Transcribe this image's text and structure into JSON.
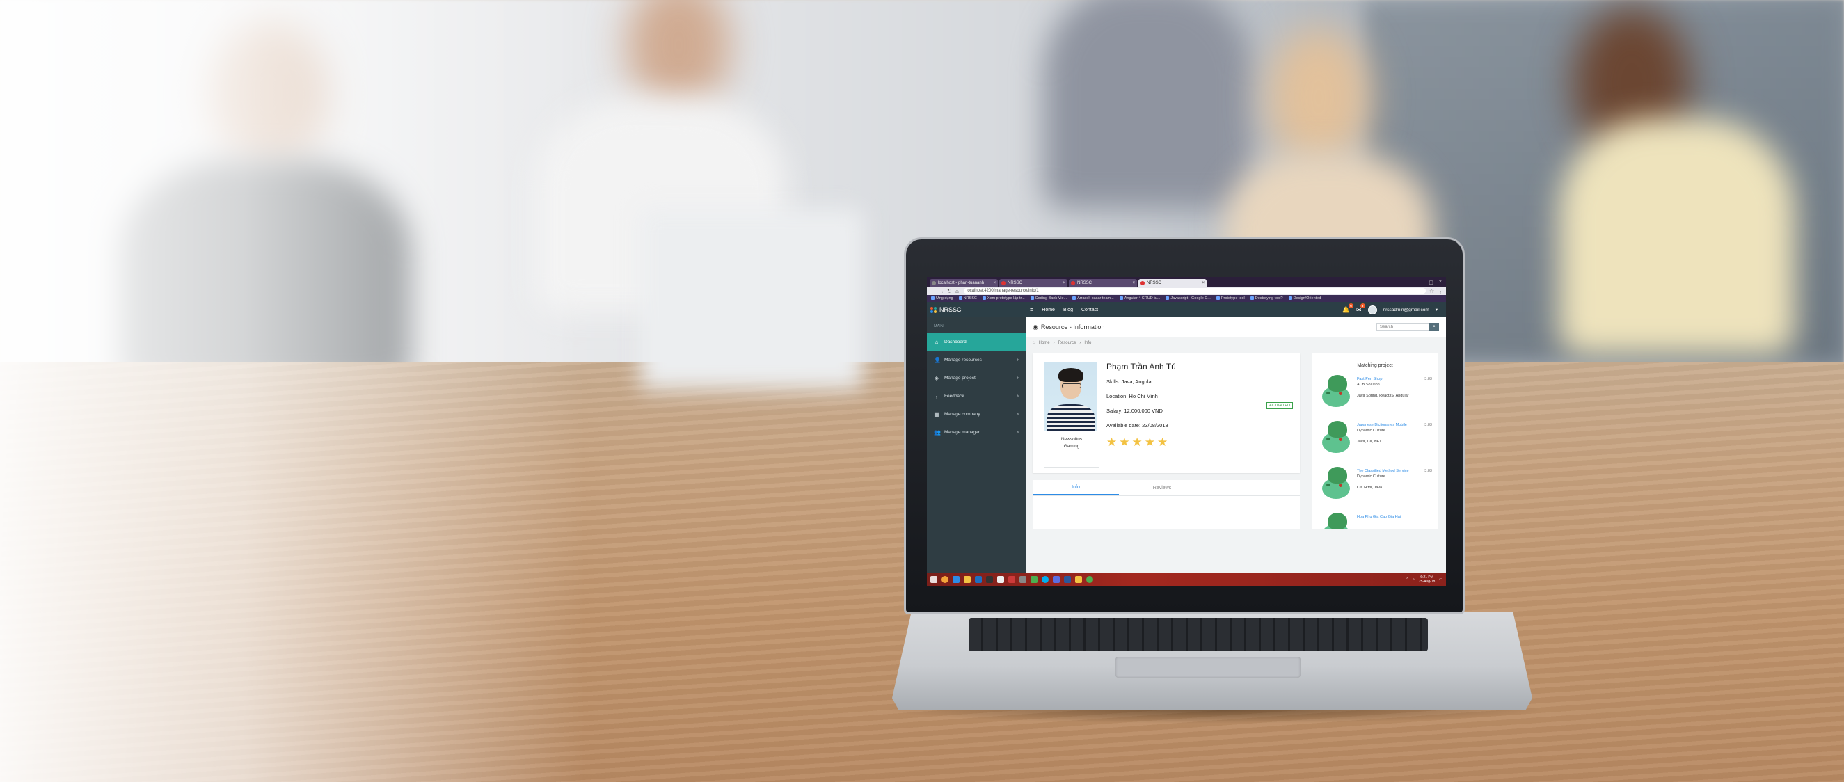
{
  "browser": {
    "tabs": [
      {
        "title": "localhost - phan-tuananh",
        "active": false
      },
      {
        "title": "NRSSC",
        "active": false
      },
      {
        "title": "NRSSC",
        "active": false
      },
      {
        "title": "NRSSC",
        "active": true
      }
    ],
    "url": "localhost:4200/manage-resource/info/1",
    "bookmarks": [
      "Ứng dụng",
      "NRSSC",
      "Xem prototype lập tr...",
      "Coding Bank Vie...",
      "Arrasek pasar team...",
      "Angular 4 CRUD tu...",
      "Javascript - Google D...",
      "Prototype tool",
      "Destroying tool?",
      "Design/Oriented"
    ]
  },
  "app": {
    "brand": "NRSSC",
    "topnav": [
      "Home",
      "Blog",
      "Contact"
    ],
    "notifications": [
      "6",
      "5"
    ],
    "user_email": "nrssadmin@gmail.com",
    "sidebar": {
      "caption": "MAIN",
      "items": [
        {
          "label": "Dashboard",
          "icon": "home-icon",
          "active": true,
          "has_children": false
        },
        {
          "label": "Manage resources",
          "icon": "users-icon",
          "active": false,
          "has_children": true
        },
        {
          "label": "Manage project",
          "icon": "layers-icon",
          "active": false,
          "has_children": true
        },
        {
          "label": "Feedback",
          "icon": "feedback-icon",
          "active": false,
          "has_children": true
        },
        {
          "label": "Manage company",
          "icon": "building-icon",
          "active": false,
          "has_children": true
        },
        {
          "label": "Manage manager",
          "icon": "group-icon",
          "active": false,
          "has_children": true
        }
      ]
    },
    "page_title": "Resource - Information",
    "search_placeholder": "Search",
    "breadcrumb": [
      "Home",
      "Resource",
      "Info"
    ],
    "profile": {
      "name": "Phạm Trần Anh Tú",
      "photo_caption_1": "Newsoftus",
      "photo_caption_2": "Gaming",
      "skills": "Skills: Java, Angular",
      "location": "Location: Ho Chi Minh",
      "salary": "Salary: 12,000,000 VND",
      "available": "Available date: 23/08/2018",
      "status": "ACTIVATED",
      "rating": 5
    },
    "tabs": [
      "Info",
      "Reviews"
    ],
    "matching": {
      "title": "Matching project",
      "items": [
        {
          "name": "Fast Pen Shop",
          "company": "ACB Solution",
          "score": "3.83",
          "tags": "Java Spring, ReactJS, Angular"
        },
        {
          "name": "Japanese Dictionaries Mobile",
          "company": "Dynamic Culture",
          "score": "3.83",
          "tags": "Java, C#, NFT"
        },
        {
          "name": "The Classified Method Service",
          "company": "Dynamic Culture",
          "score": "3.83",
          "tags": "C#, Html, Java"
        },
        {
          "name": "Hoa Phu Gia Cao Gia Hai",
          "company": "",
          "score": "",
          "tags": ""
        }
      ]
    }
  },
  "taskbar": {
    "time": "6:21 PM",
    "date": "25-Aug-18"
  }
}
